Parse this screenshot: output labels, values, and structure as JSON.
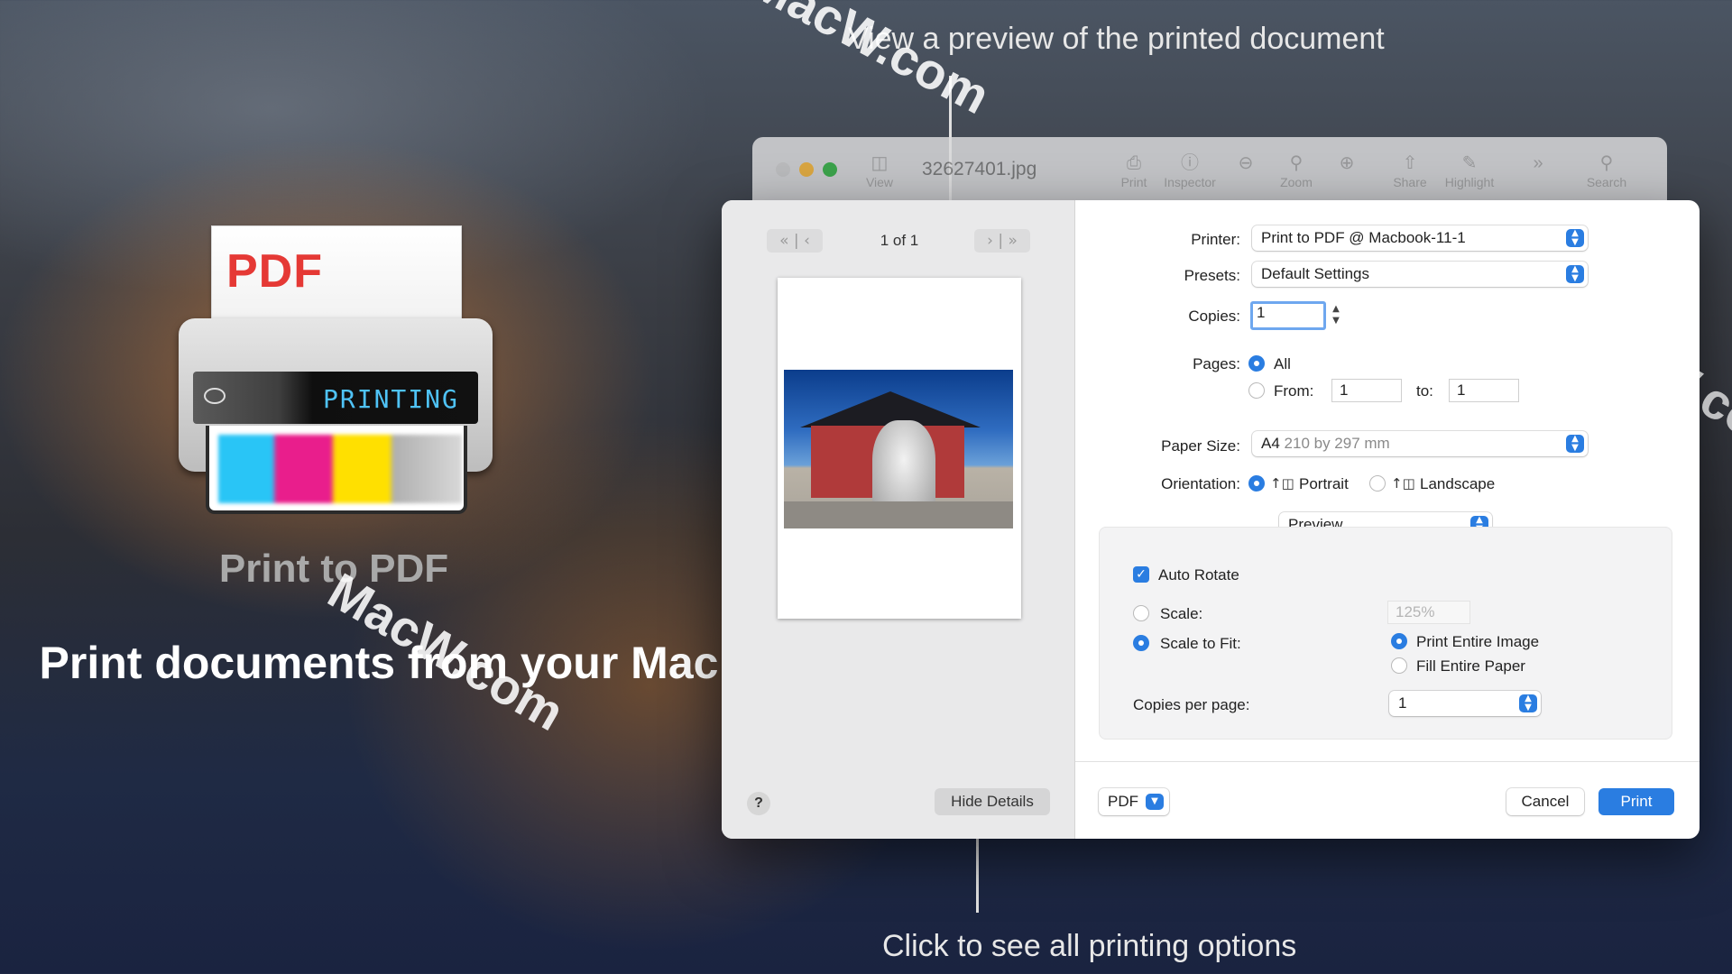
{
  "promo": {
    "printer_paper_text": "PDF",
    "printer_screen_text": "PRINTING",
    "app_name": "Print to PDF",
    "tagline": "Print documents from your Mac",
    "callout_top": "View a preview of the printed document",
    "callout_bottom": "Click to see all printing options",
    "watermark": "MacW.com"
  },
  "background_window": {
    "title": "32627401.jpg",
    "toolbar": [
      {
        "label": "View",
        "icon": "sidebar-icon"
      },
      {
        "label": "Print",
        "icon": "print-icon"
      },
      {
        "label": "Inspector",
        "icon": "info-icon"
      },
      {
        "label": "",
        "icon": "zoom-out-icon"
      },
      {
        "label": "Zoom",
        "icon": "zoom-icon"
      },
      {
        "label": "",
        "icon": "zoom-in-icon"
      },
      {
        "label": "Share",
        "icon": "share-icon"
      },
      {
        "label": "Highlight",
        "icon": "highlight-icon"
      },
      {
        "label": "",
        "icon": "more-icon"
      },
      {
        "label": "Search",
        "icon": "search-icon"
      }
    ]
  },
  "dialog": {
    "page_count": "1 of 1",
    "help_label": "?",
    "hide_details_label": "Hide Details",
    "printer_label": "Printer:",
    "printer_value": "Print to PDF @ Macbook-11-1",
    "presets_label": "Presets:",
    "presets_value": "Default Settings",
    "copies_label": "Copies:",
    "copies_value": "1",
    "pages_label": "Pages:",
    "pages_all_label": "All",
    "pages_from_label": "From:",
    "pages_from_value": "1",
    "pages_to_label": "to:",
    "pages_to_value": "1",
    "paper_size_label": "Paper Size:",
    "paper_size_value": "A4",
    "paper_size_detail": "210 by 297 mm",
    "orientation_label": "Orientation:",
    "portrait_label": "Portrait",
    "landscape_label": "Landscape",
    "section_value": "Preview",
    "auto_rotate_label": "Auto Rotate",
    "scale_label": "Scale:",
    "scale_value": "125%",
    "scale_to_fit_label": "Scale to Fit:",
    "print_entire_image_label": "Print Entire Image",
    "fill_entire_paper_label": "Fill Entire Paper",
    "copies_per_page_label": "Copies per page:",
    "copies_per_page_value": "1",
    "pdf_label": "PDF",
    "cancel_label": "Cancel",
    "print_label": "Print"
  },
  "colors": {
    "accent": "#2a7de1"
  }
}
